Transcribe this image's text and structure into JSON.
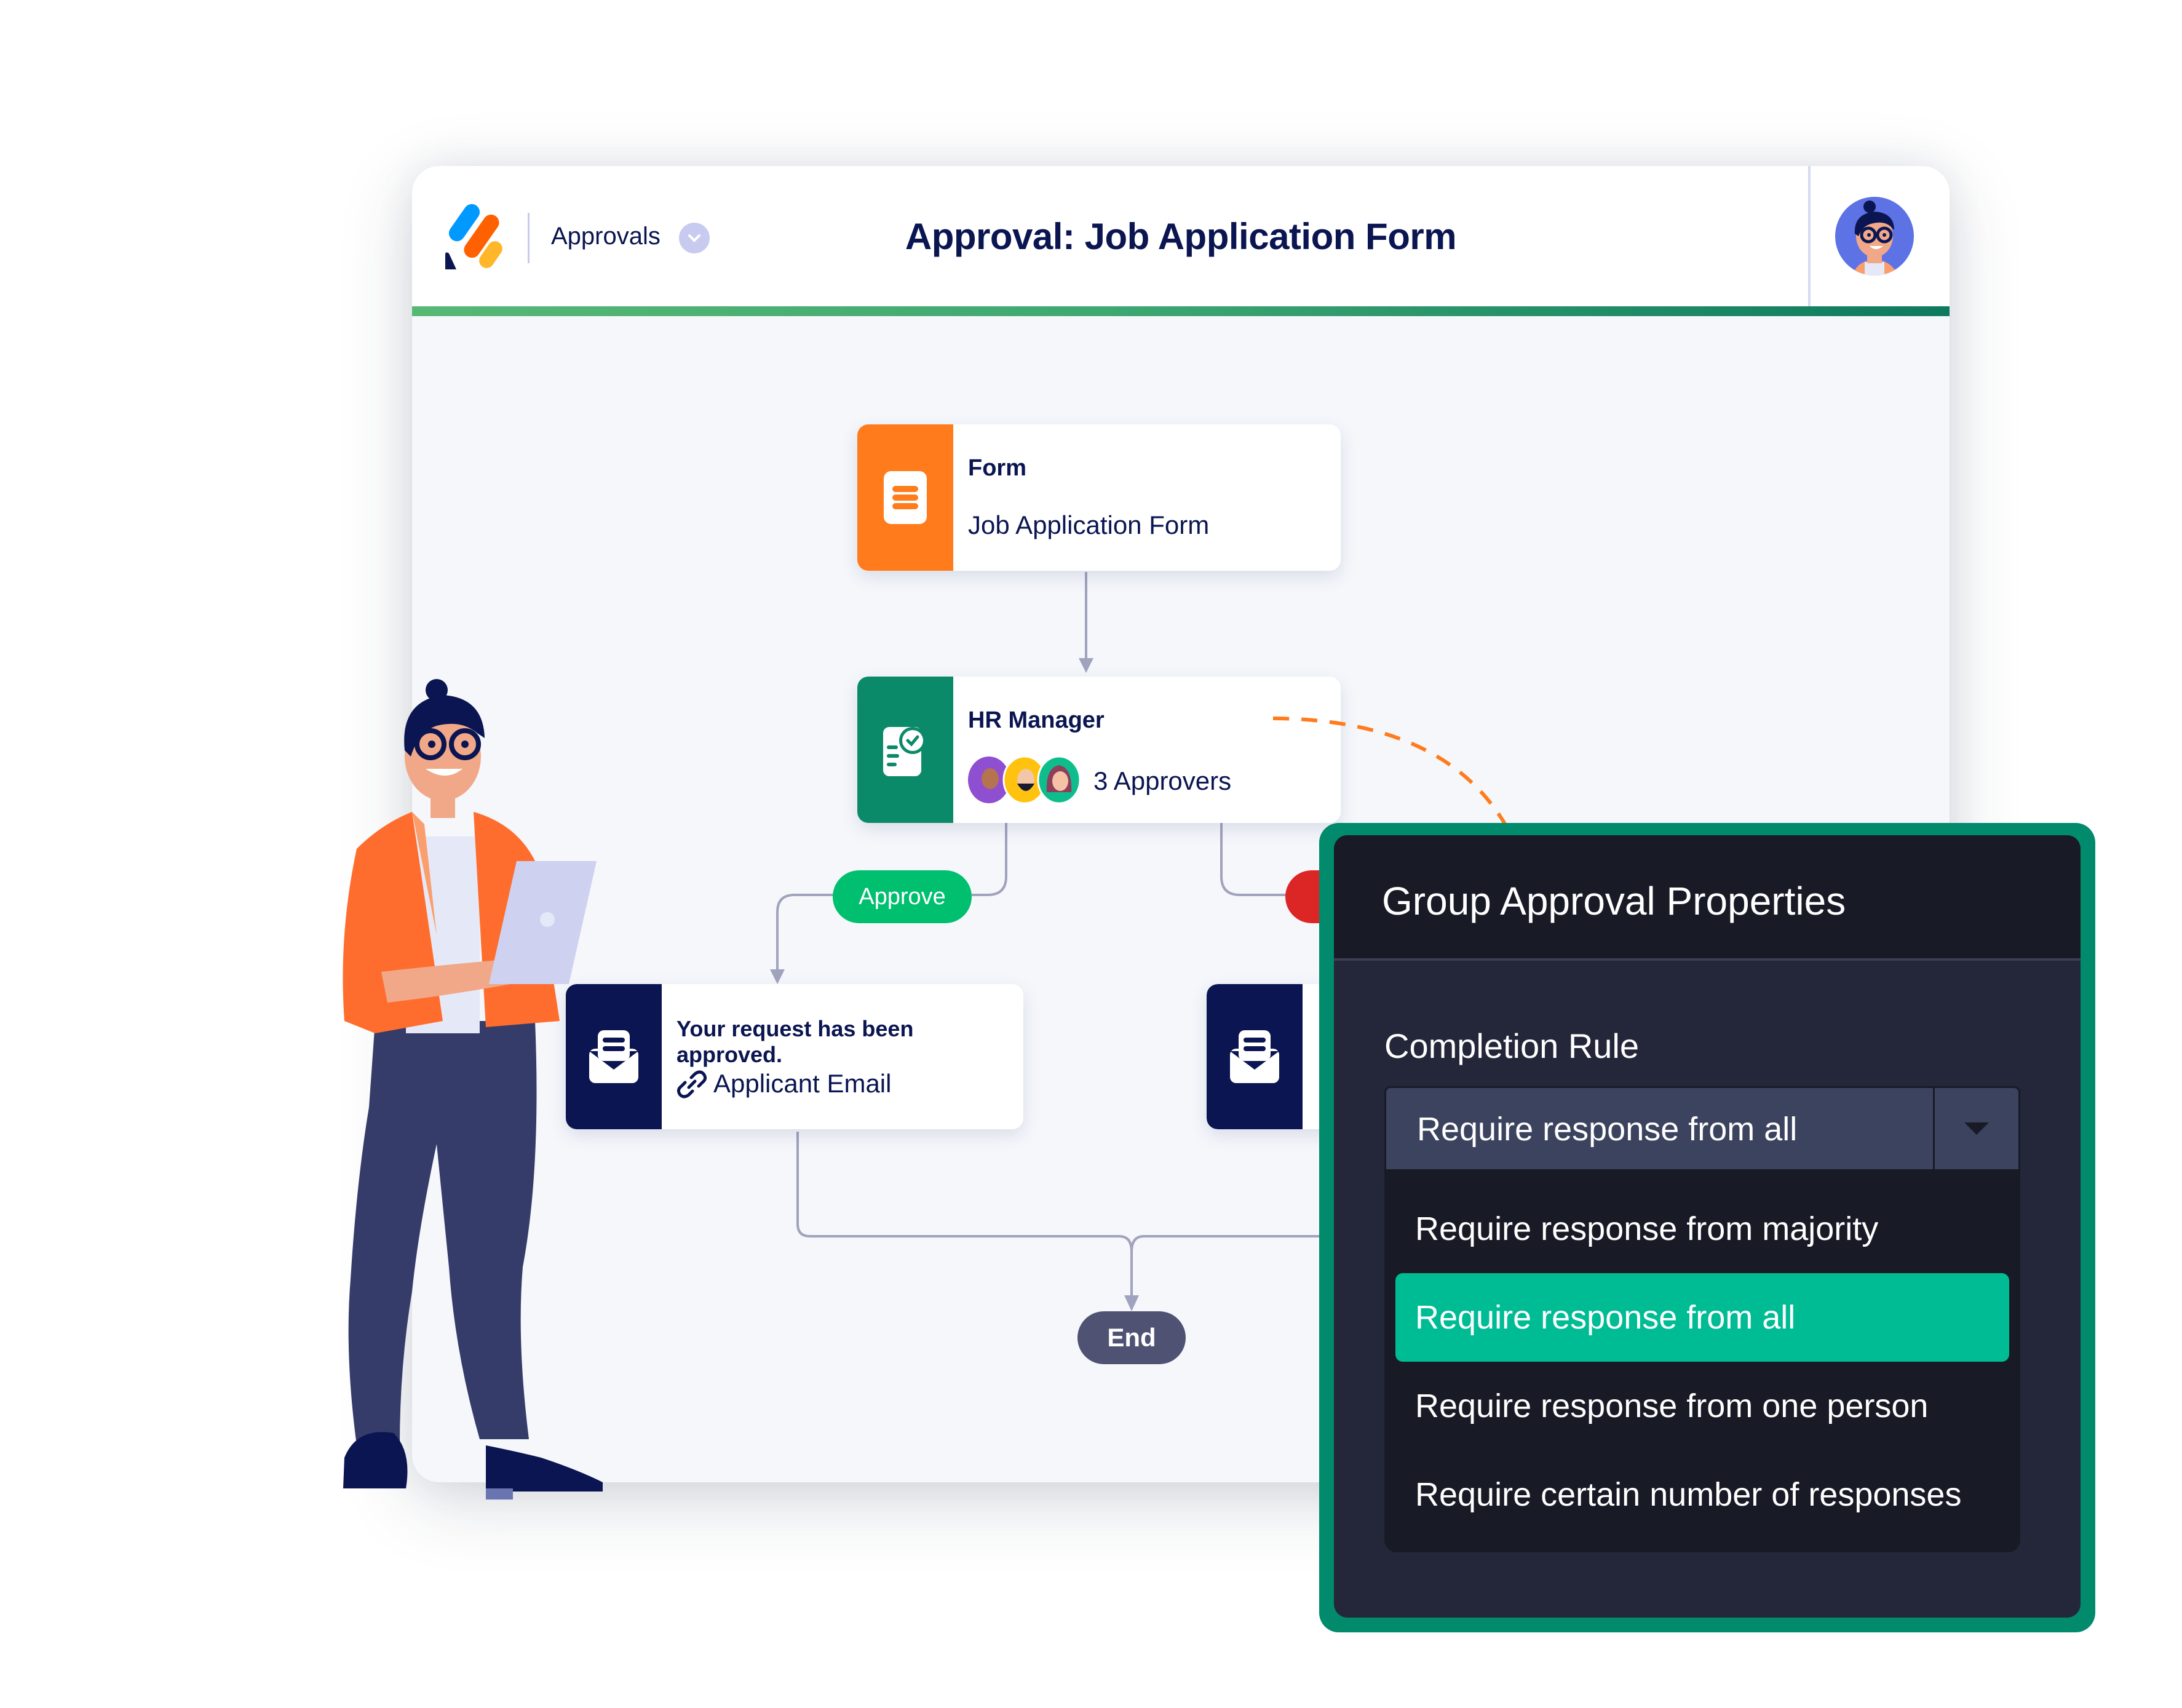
{
  "header": {
    "app_name": "Approvals",
    "title": "Approval: Job Application Form",
    "icons": {
      "logo": "jotform-logo",
      "app_chevron": "chevron-down-icon",
      "avatar": "user-avatar"
    }
  },
  "flow": {
    "form_node": {
      "label": "Form",
      "value": "Job Application Form",
      "icon": "form-icon",
      "color": "#ff7b1c"
    },
    "approver_node": {
      "label": "HR Manager",
      "approvers_text": "3 Approvers",
      "icon": "approval-icon",
      "color": "#0b8a6a",
      "approver_count": 3
    },
    "approve_branch": {
      "label": "Approve",
      "color": "#00bf6f"
    },
    "deny_branch": {
      "color": "#dc2626"
    },
    "email_node": {
      "label": "Your request has been approved.",
      "recipient": "Applicant Email",
      "icon": "email-icon",
      "link_icon": "link-icon",
      "color": "#0a1551"
    },
    "end_node": {
      "label": "End",
      "color": "#505274"
    }
  },
  "panel": {
    "title": "Group Approval Properties",
    "field_label": "Completion Rule",
    "selected_value": "Require response from all",
    "options": [
      {
        "label": "Require response from majority",
        "selected": false
      },
      {
        "label": "Require response from all",
        "selected": true
      },
      {
        "label": "Require response from one person",
        "selected": false
      },
      {
        "label": "Require certain number of responses",
        "selected": false
      }
    ],
    "accent": "#018a6c",
    "selected_color": "#00bc94"
  }
}
